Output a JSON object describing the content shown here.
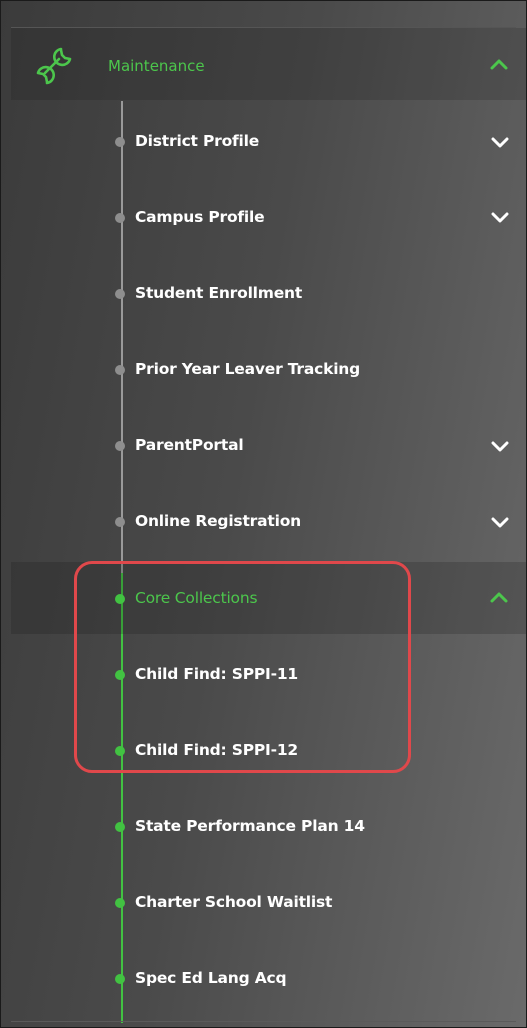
{
  "menu": {
    "section": {
      "label": "Maintenance",
      "icon": "wrench-icon",
      "expanded": true
    },
    "items": [
      {
        "label": "District Profile",
        "has_submenu": true
      },
      {
        "label": "Campus Profile",
        "has_submenu": true
      },
      {
        "label": "Student Enrollment",
        "has_submenu": false
      },
      {
        "label": "Prior Year Leaver Tracking",
        "has_submenu": false
      },
      {
        "label": "ParentPortal",
        "has_submenu": true
      },
      {
        "label": "Online Registration",
        "has_submenu": true
      },
      {
        "label": "Core Collections",
        "has_submenu": true,
        "expanded": true,
        "active": true
      },
      {
        "label": "Child Find: SPPI-11",
        "has_submenu": false
      },
      {
        "label": "Child Find: SPPI-12",
        "has_submenu": false
      },
      {
        "label": "State Performance Plan 14",
        "has_submenu": false
      },
      {
        "label": "Charter School Waitlist",
        "has_submenu": false
      },
      {
        "label": "Spec Ed Lang Acq",
        "has_submenu": false
      }
    ]
  },
  "colors": {
    "accent_green": "#4cc64c",
    "text_white": "#ffffff",
    "highlight_red": "#e0484b",
    "rail_gray": "#9a9a9a"
  }
}
